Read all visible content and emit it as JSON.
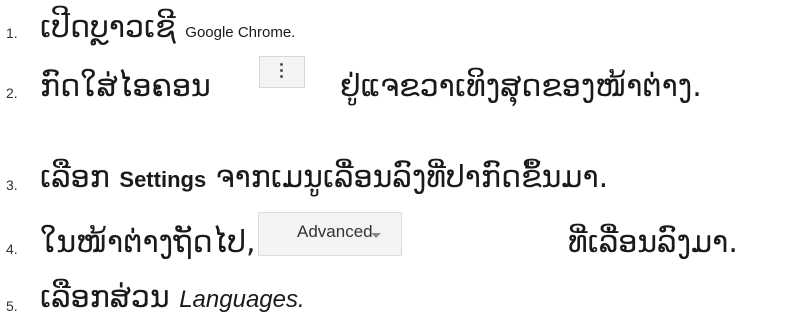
{
  "steps": [
    {
      "number": "1.",
      "text_lao": "ເປີດບຼາວເຊີ",
      "text_app": "Google Chrome",
      "text_end": "."
    },
    {
      "number": "2.",
      "text_a": "ກົດໃສ່ໄອຄອນ",
      "text_b": "ຢູ່ແຈຂວາເທິງສຸດຂອງໜ້າຕ່າງ."
    },
    {
      "number": "3.",
      "text_a": "ເລືອກ",
      "text_bold": "Settings",
      "text_b": "ຈາກເມນູເລື່ອນລົງທີ່ປາກົດຂຶ້ນມາ."
    },
    {
      "number": "4.",
      "text_a": "ໃນໜ້າຕ່າງຖັດໄປ, ກົດ",
      "text_b": "ທີ່ເລື່ອນລົງມາ."
    },
    {
      "number": "5.",
      "text_a": "ເລືອກສ່ວນ",
      "text_ital": "Languages",
      "text_end": "."
    }
  ],
  "advanced_button": {
    "label": "Advanced"
  },
  "icons": {
    "kebab": "kebab-menu-icon",
    "caret": "chevron-down-icon"
  },
  "colors": {
    "text": "#1a1a1a",
    "button_bg": "#f4f4f4",
    "button_border": "#dcdcdc"
  }
}
